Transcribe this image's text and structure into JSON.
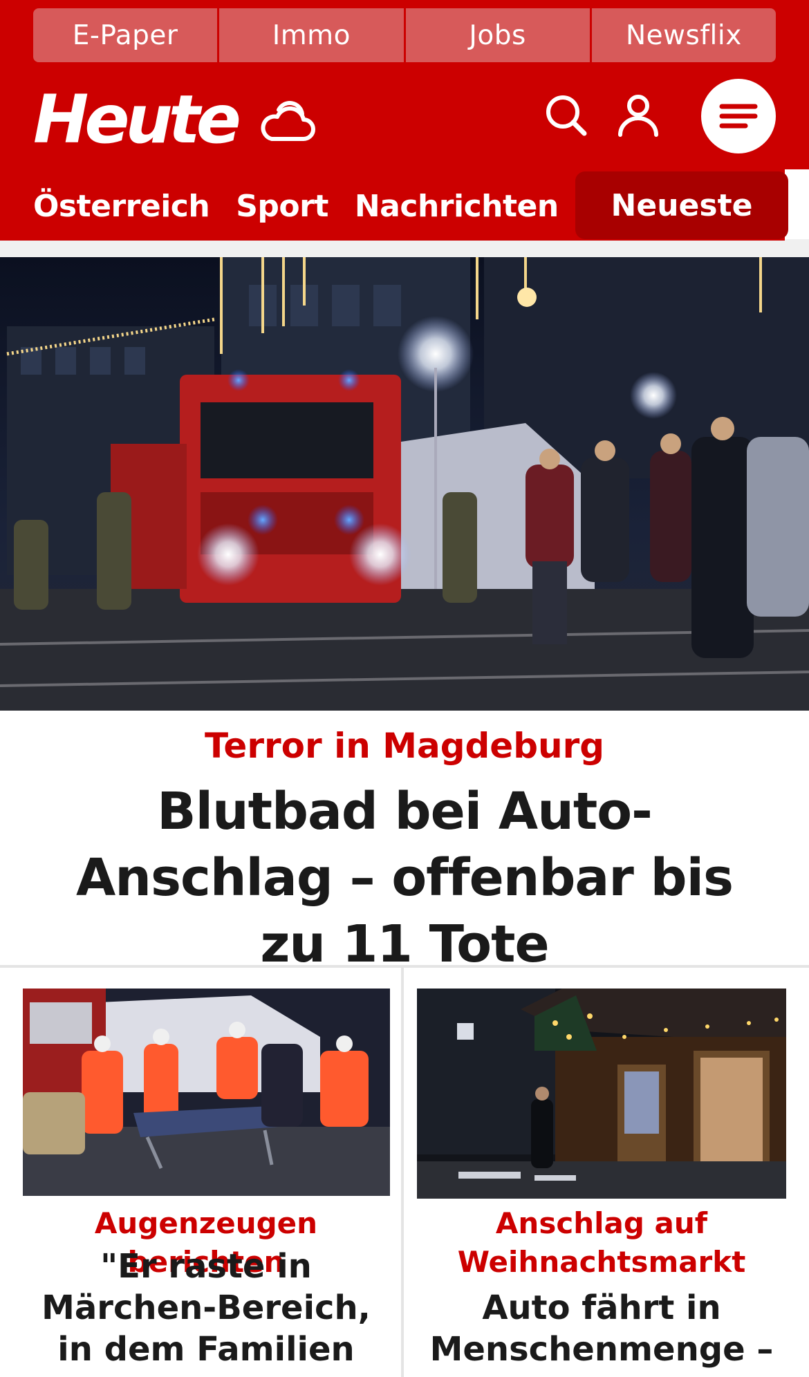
{
  "topnav": [
    "E-Paper",
    "Immo",
    "Jobs",
    "Newsflix"
  ],
  "brand": {
    "logo": "Heute",
    "red": "#cc0000",
    "dark_red": "#a80000"
  },
  "icons": {
    "weather": "cloud-sun-icon",
    "search": "search-icon",
    "user": "user-icon",
    "menu": "menu-icon"
  },
  "categories": [
    "Österreich",
    "Sport",
    "Nachrichten",
    "Neueste"
  ],
  "hero": {
    "kicker": "Terror in Magdeburg",
    "title": "Blutbad bei Auto-Anschlag – offenbar bis zu 11 Tote"
  },
  "teasers": [
    {
      "kicker": "Augenzeugen berichten",
      "title": "\"Er raste in Märchen-Bereich, in dem Familien waren\""
    },
    {
      "kicker": "Anschlag auf Weihnachtsmarkt",
      "title": "Auto fährt in Menschenmenge –"
    }
  ]
}
